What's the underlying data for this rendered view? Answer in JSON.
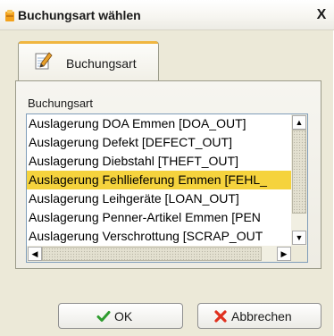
{
  "window": {
    "title": "Buchungsart wählen",
    "close_label": "X"
  },
  "tab": {
    "label": "Buchungsart"
  },
  "panel": {
    "label": "Buchungsart"
  },
  "list": {
    "items": [
      "Auslagerung DOA Emmen [DOA_OUT]",
      "Auslagerung Defekt [DEFECT_OUT]",
      "Auslagerung Diebstahl [THEFT_OUT]",
      "Auslagerung Fehllieferung Emmen [FEHL_",
      "Auslagerung Leihgeräte [LOAN_OUT]",
      "Auslagerung Penner-Artikel Emmen [PEN",
      "Auslagerung Verschrottung [SCRAP_OUT"
    ],
    "selected_index": 3
  },
  "scroll_glyphs": {
    "up": "▲",
    "down": "▼",
    "left": "◀",
    "right": "▶"
  },
  "buttons": {
    "ok_label": "OK",
    "cancel_label": "Abbrechen"
  },
  "colors": {
    "selection": "#f5d33d",
    "tab_accent": "#f0b640",
    "ok_check": "#2e9c2e",
    "cancel_x": "#e0301e"
  }
}
